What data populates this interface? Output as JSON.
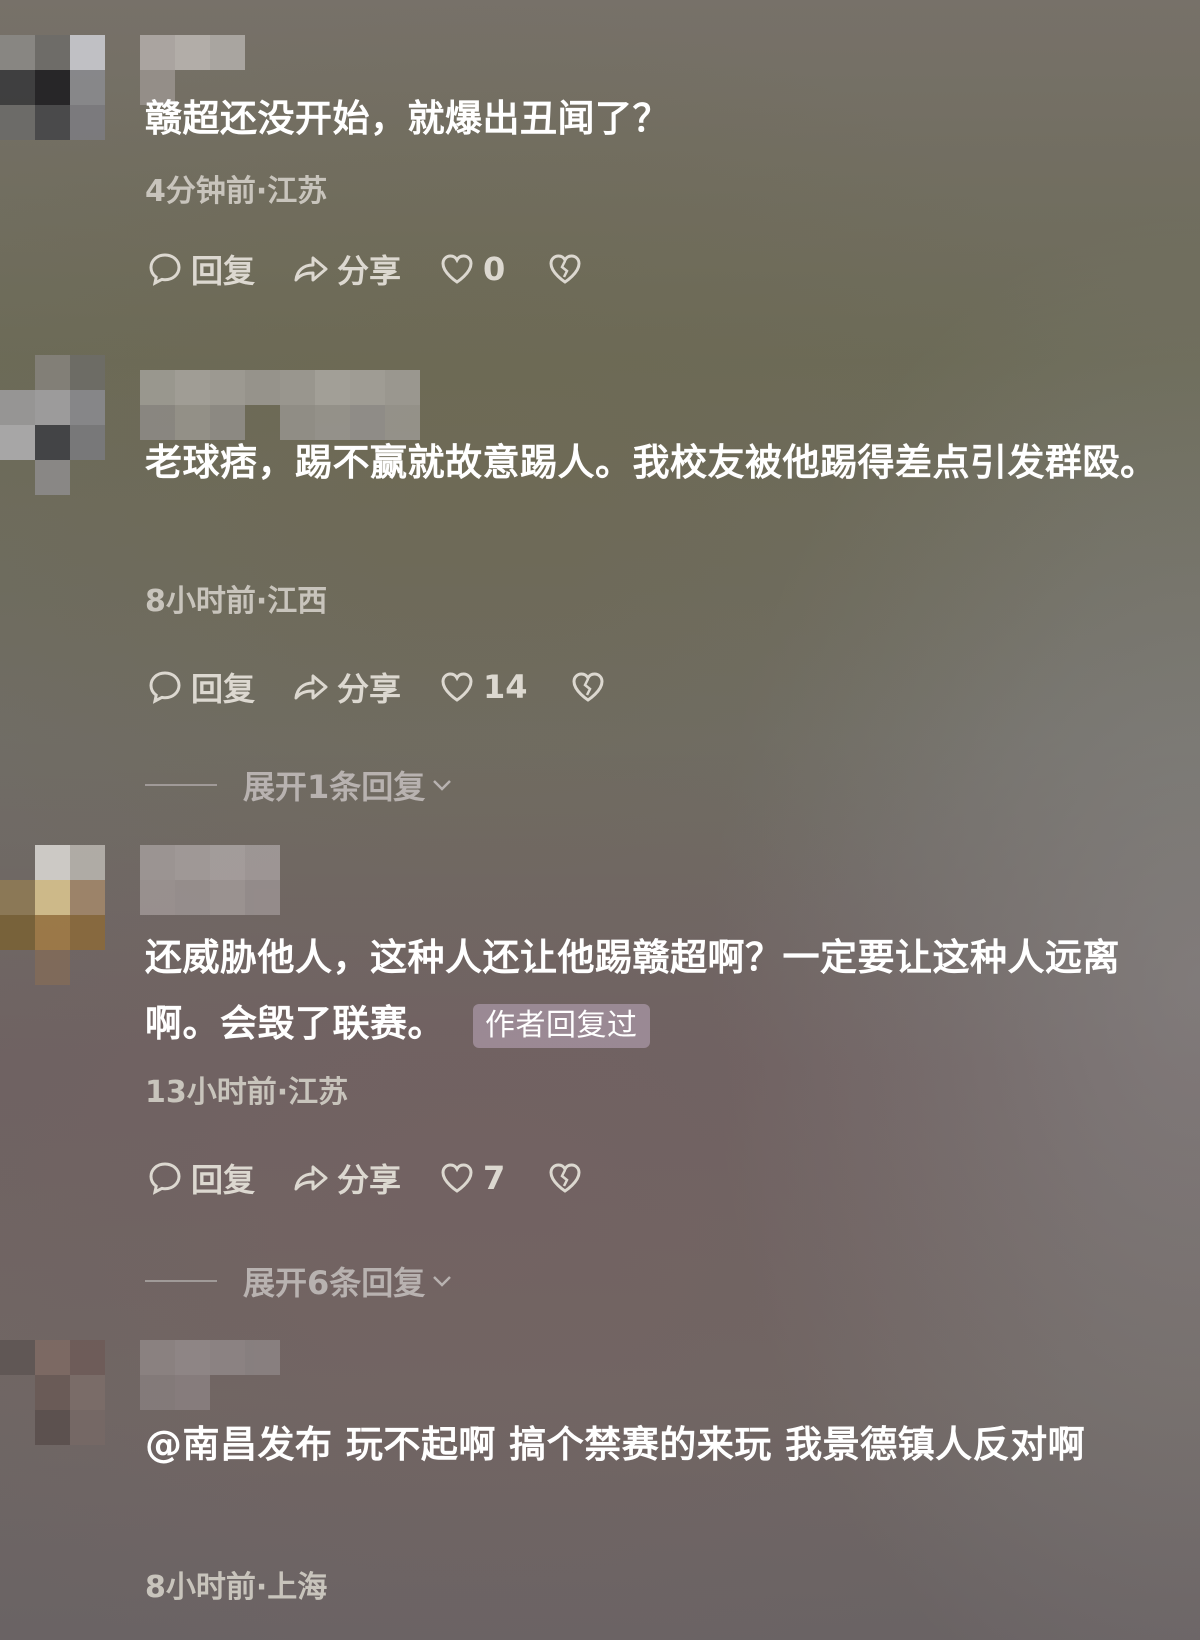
{
  "comments": [
    {
      "text": "赣超还没开始，就爆出丑闻了？",
      "meta": "4分钟前·江苏",
      "actions": {
        "reply": "回复",
        "share": "分享",
        "likes": "0"
      }
    },
    {
      "text": "老球痞，踢不赢就故意踢人。我校友被他踢得差点引发群殴。",
      "meta": "8小时前·江西",
      "actions": {
        "reply": "回复",
        "share": "分享",
        "likes": "14"
      },
      "expand": "展开1条回复"
    },
    {
      "text": "还威胁他人，这种人还让他踢赣超啊？一定要让这种人远离啊。会毁了联赛。",
      "badge": "作者回复过",
      "meta": "13小时前·江苏",
      "actions": {
        "reply": "回复",
        "share": "分享",
        "likes": "7"
      },
      "expand": "展开6条回复"
    },
    {
      "text": "@南昌发布  玩不起啊 搞个禁赛的来玩 我景德镇人反对啊",
      "meta": "8小时前·上海"
    }
  ],
  "icons": {
    "reply": "comment-bubble-icon",
    "share": "share-arrow-icon",
    "like": "heart-outline-icon",
    "dislike": "broken-heart-icon",
    "expand": "chevron-down-icon"
  },
  "colors": {
    "text": "#ffffff",
    "meta": "#c8c4bc",
    "badge_bg": "#bfa9bf"
  }
}
